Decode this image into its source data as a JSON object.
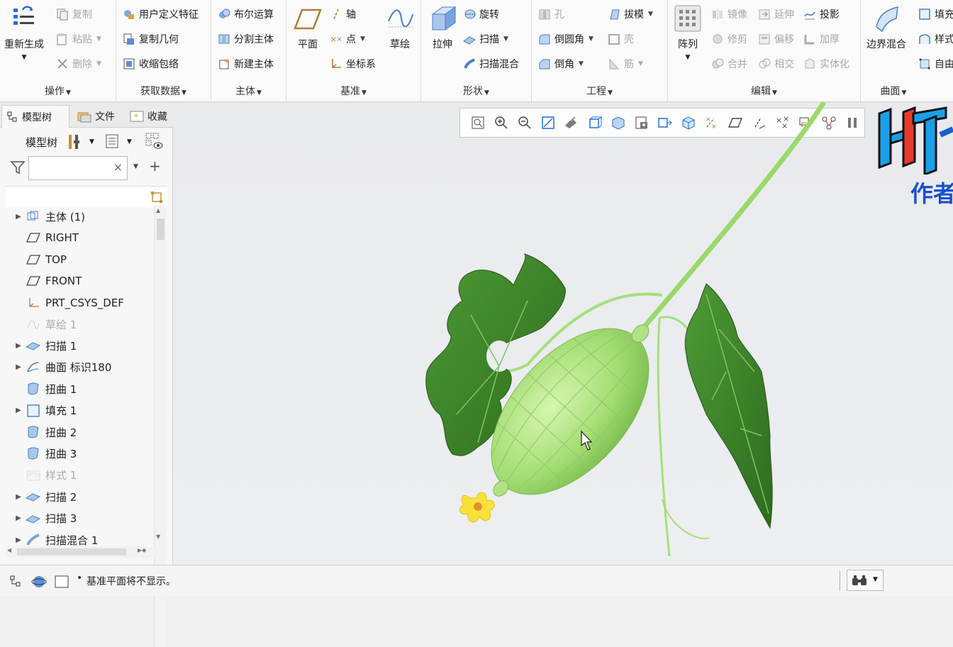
{
  "ribbon": {
    "groups": {
      "operations": {
        "label": "操作",
        "regenerate": "重新生成",
        "copy": "复制",
        "paste": "粘贴",
        "delete": "删除"
      },
      "get_data": {
        "label": "获取数据",
        "user_defined_feature": "用户定义特征",
        "copy_geometry": "复制几何",
        "shrinkwrap": "收缩包络"
      },
      "body": {
        "label": "主体",
        "boolean": "布尔运算",
        "split_body": "分割主体",
        "new_body": "新建主体"
      },
      "datum": {
        "label": "基准",
        "plane": "平面",
        "axis": "轴",
        "point": "点",
        "csys": "坐标系",
        "sketch": "草绘"
      },
      "shapes": {
        "label": "形状",
        "extrude": "拉伸",
        "revolve": "旋转",
        "sweep": "扫描",
        "swept_blend": "扫描混合"
      },
      "engineering": {
        "label": "工程",
        "hole": "孔",
        "round": "倒圆角",
        "chamfer": "倒角",
        "draft": "拔模",
        "shell": "壳",
        "rib": "筋"
      },
      "editing": {
        "label": "编辑",
        "pattern": "阵列",
        "mirror": "镜像",
        "trim": "修剪",
        "merge": "合并",
        "extend": "延伸",
        "offset": "偏移",
        "intersect": "相交",
        "project": "投影",
        "thicken": "加厚",
        "solidify": "实体化"
      },
      "surfaces": {
        "label": "曲面",
        "boundary_blend": "边界混合",
        "fill": "填充",
        "style": "样式",
        "freestyle": "自由"
      }
    }
  },
  "left_panel": {
    "tabs": [
      "模型树",
      "文件",
      "收藏"
    ],
    "tree_label": "模型树",
    "search": {
      "value": "",
      "placeholder": ""
    },
    "tree_items": [
      {
        "label": "主体 (1)",
        "icon": "body-icon",
        "expandable": true,
        "disabled": false
      },
      {
        "label": "RIGHT",
        "icon": "datum-plane-icon",
        "expandable": false,
        "disabled": false
      },
      {
        "label": "TOP",
        "icon": "datum-plane-icon",
        "expandable": false,
        "disabled": false
      },
      {
        "label": "FRONT",
        "icon": "datum-plane-icon",
        "expandable": false,
        "disabled": false
      },
      {
        "label": "PRT_CSYS_DEF",
        "icon": "csys-icon",
        "expandable": false,
        "disabled": false
      },
      {
        "label": "草绘 1",
        "icon": "sketch-icon",
        "expandable": false,
        "disabled": true
      },
      {
        "label": "扫描 1",
        "icon": "sweep-icon",
        "expandable": true,
        "disabled": false
      },
      {
        "label": "曲面 标识180",
        "icon": "surface-icon",
        "expandable": true,
        "disabled": false
      },
      {
        "label": "扭曲 1",
        "icon": "warp-icon",
        "expandable": false,
        "disabled": false
      },
      {
        "label": "填充 1",
        "icon": "fill-icon",
        "expandable": true,
        "disabled": false
      },
      {
        "label": "扭曲 2",
        "icon": "warp-icon",
        "expandable": false,
        "disabled": false
      },
      {
        "label": "扭曲 3",
        "icon": "warp-icon",
        "expandable": false,
        "disabled": false
      },
      {
        "label": "样式 1",
        "icon": "style-icon",
        "expandable": false,
        "disabled": true
      },
      {
        "label": "扫描 2",
        "icon": "sweep-icon",
        "expandable": true,
        "disabled": false
      },
      {
        "label": "扫描 3",
        "icon": "sweep-icon",
        "expandable": true,
        "disabled": false
      },
      {
        "label": "扫描混合 1",
        "icon": "swept-blend-icon",
        "expandable": true,
        "disabled": false
      }
    ]
  },
  "viewport": {
    "view_toolbar": [
      "refit-icon",
      "zoom-in-icon",
      "zoom-out-icon",
      "repaint-icon",
      "display-style-icon",
      "saved-views-icon",
      "view-manager-icon",
      "perspective-icon",
      "section-icon",
      "spin-center-icon",
      "datum-display-icon",
      "plane-display-icon",
      "axis-display-icon",
      "point-display-icon",
      "csys-display-icon",
      "annotation-display-icon",
      "pause-icon"
    ],
    "watermark": {
      "logo_text": "HT",
      "caption": "作者"
    }
  },
  "status_bar": {
    "message": "基准平面将不显示。"
  },
  "colors": {
    "accent": "#1e6fd9",
    "fruit": "#a8e07a",
    "leaf": "#3f8a2a",
    "stem": "#9ad96a",
    "flower": "#f7e23a"
  }
}
